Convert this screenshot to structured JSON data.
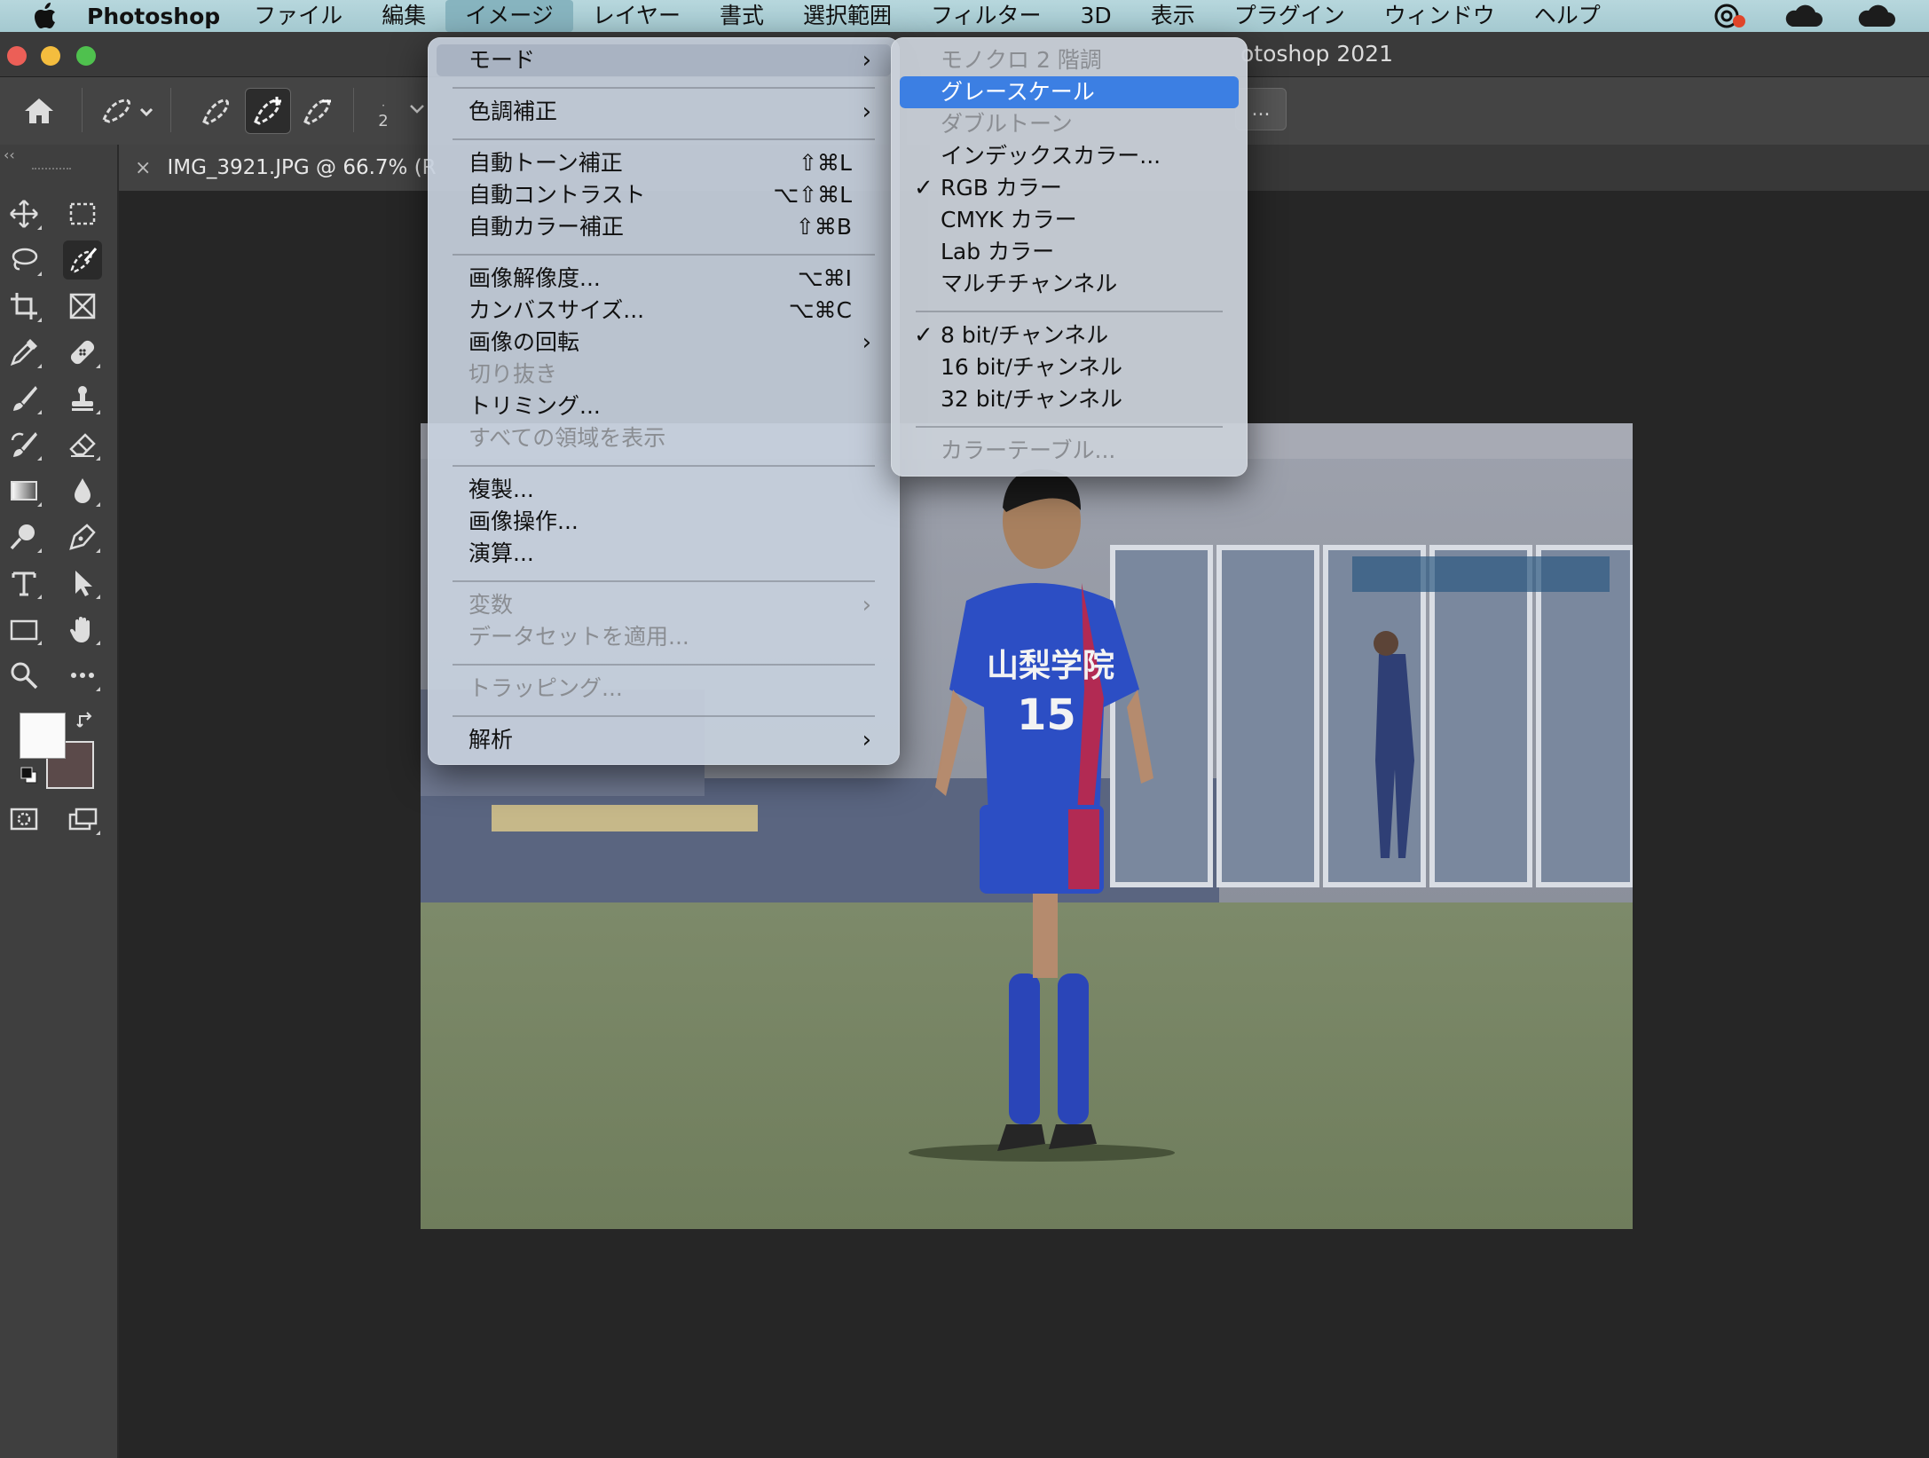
{
  "menubar": {
    "app_name": "Photoshop",
    "items": [
      "ファイル",
      "編集",
      "イメージ",
      "レイヤー",
      "書式",
      "選択範囲",
      "フィルター",
      "3D",
      "表示",
      "プラグイン",
      "ウィンドウ",
      "ヘルプ"
    ],
    "active_item": "イメージ"
  },
  "window": {
    "title_fragment": "otoshop 2021"
  },
  "options_bar": {
    "size_value": "2",
    "more_button": "..."
  },
  "document": {
    "tab_title": "IMG_3921.JPG @ 66.7% (R",
    "close_glyph": "×"
  },
  "image_menu": {
    "items": [
      {
        "label": "モード",
        "submenu": true,
        "state": "hover"
      },
      {
        "label": "色調補正",
        "submenu": true
      },
      {
        "label": "自動トーン補正",
        "shortcut": "⇧⌘L"
      },
      {
        "label": "自動コントラスト",
        "shortcut": "⌥⇧⌘L"
      },
      {
        "label": "自動カラー補正",
        "shortcut": "⇧⌘B"
      },
      {
        "label": "画像解像度...",
        "shortcut": "⌥⌘I"
      },
      {
        "label": "カンバスサイズ...",
        "shortcut": "⌥⌘C"
      },
      {
        "label": "画像の回転",
        "submenu": true
      },
      {
        "label": "切り抜き",
        "disabled": true
      },
      {
        "label": "トリミング..."
      },
      {
        "label": "すべての領域を表示",
        "disabled": true
      },
      {
        "label": "複製..."
      },
      {
        "label": "画像操作..."
      },
      {
        "label": "演算..."
      },
      {
        "label": "変数",
        "submenu": true,
        "disabled": true
      },
      {
        "label": "データセットを適用...",
        "disabled": true
      },
      {
        "label": "トラッピング...",
        "disabled": true
      },
      {
        "label": "解析",
        "submenu": true
      }
    ]
  },
  "mode_submenu": {
    "items": [
      {
        "label": "モノクロ 2 階調",
        "disabled": true
      },
      {
        "label": "グレースケール",
        "state": "highlighted"
      },
      {
        "label": "ダブルトーン",
        "disabled": true
      },
      {
        "label": "インデックスカラー..."
      },
      {
        "label": "RGB カラー",
        "checked": true
      },
      {
        "label": "CMYK カラー"
      },
      {
        "label": "Lab カラー"
      },
      {
        "label": "マルチチャンネル"
      },
      {
        "label": "8 bit/チャンネル",
        "checked": true
      },
      {
        "label": "16 bit/チャンネル"
      },
      {
        "label": "32 bit/チャンネル"
      },
      {
        "label": "カラーテーブル...",
        "disabled": true
      }
    ]
  },
  "glyphs": {
    "submenu_arrow": "›",
    "checkmark": "✓"
  },
  "photo": {
    "jersey_text": "山梨学院",
    "jersey_number": "15"
  },
  "colors": {
    "menu_highlight": "#3c7fe3",
    "foreground_swatch": "#fafafa",
    "background_swatch": "#5b4a4a"
  }
}
